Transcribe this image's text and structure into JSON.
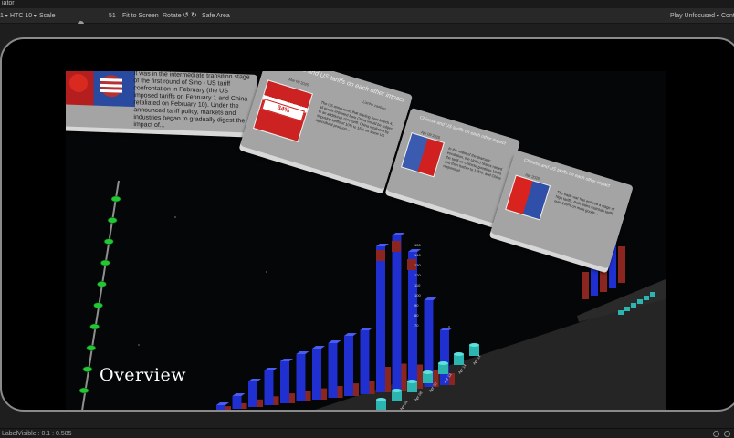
{
  "window": {
    "title_fragment": "iator"
  },
  "toolbar": {
    "display_dropdown": "1",
    "device_dropdown": "HTC 10",
    "scale_label": "Scale",
    "scale_value": "51",
    "fit_to_screen": "Fit to Screen",
    "rotate_label": "Rotate",
    "safe_area": "Safe Area",
    "play_mode": "Play Unfocused",
    "right_fragment": "Cont"
  },
  "scene": {
    "overview_label": "Overview",
    "cards": [
      {
        "title": "",
        "date": "",
        "source": "",
        "body": "It was in the intermediate transition stage of the first round of Sino - US tariff confrontation in February (the US imposed tariffs on February 1 and China retaliated on February 10). Under the announced tariff policy, markets and industries began to gradually digest the impact of..."
      },
      {
        "title": "Chinese and US tariffs on each other impact",
        "date": "Mar 09 2025",
        "source": "Lianhe zaobao",
        "image_caption": "34% TARIFFS",
        "body": "The US announced that starting from March 4, all goods imported from China would be subject to an additional 10% tariff. China retaliated by imposing tariffs of 10% to 15% on some US agricultural products..."
      },
      {
        "title": "Chinese and US tariffs on each other impact",
        "date": "Apr 09 2025",
        "source": "",
        "body": "In the midst of the dramatic escalation, the United States raised the tariff on Chinese goods to 104% and then further to 125%, and China responded..."
      },
      {
        "title": "Chinese and US tariffs on each other impact",
        "date": "Apr 2025",
        "source": "",
        "body": "The trade war has entered a stage of high tariffs. Both sides maintain tariffs over 100% on most goods..."
      }
    ],
    "axis_ticks": [
      "150",
      "140",
      "130",
      "120",
      "110",
      "100",
      "90",
      "80",
      "70"
    ],
    "x_labels": [
      "Apr 09",
      "Apr 08",
      "Apr 10",
      "Apr 13",
      "Apr 14",
      "Apr 14"
    ]
  },
  "colors": {
    "bar_blue": "#1f2fd0",
    "bar_red": "#8a2520",
    "bar_teal": "#2bb4b0",
    "slider_knob": "#22c833",
    "card_bg": "#a4a4a4"
  },
  "statusbar": {
    "text": "LabelVisible : 0.1 : 0.585"
  }
}
